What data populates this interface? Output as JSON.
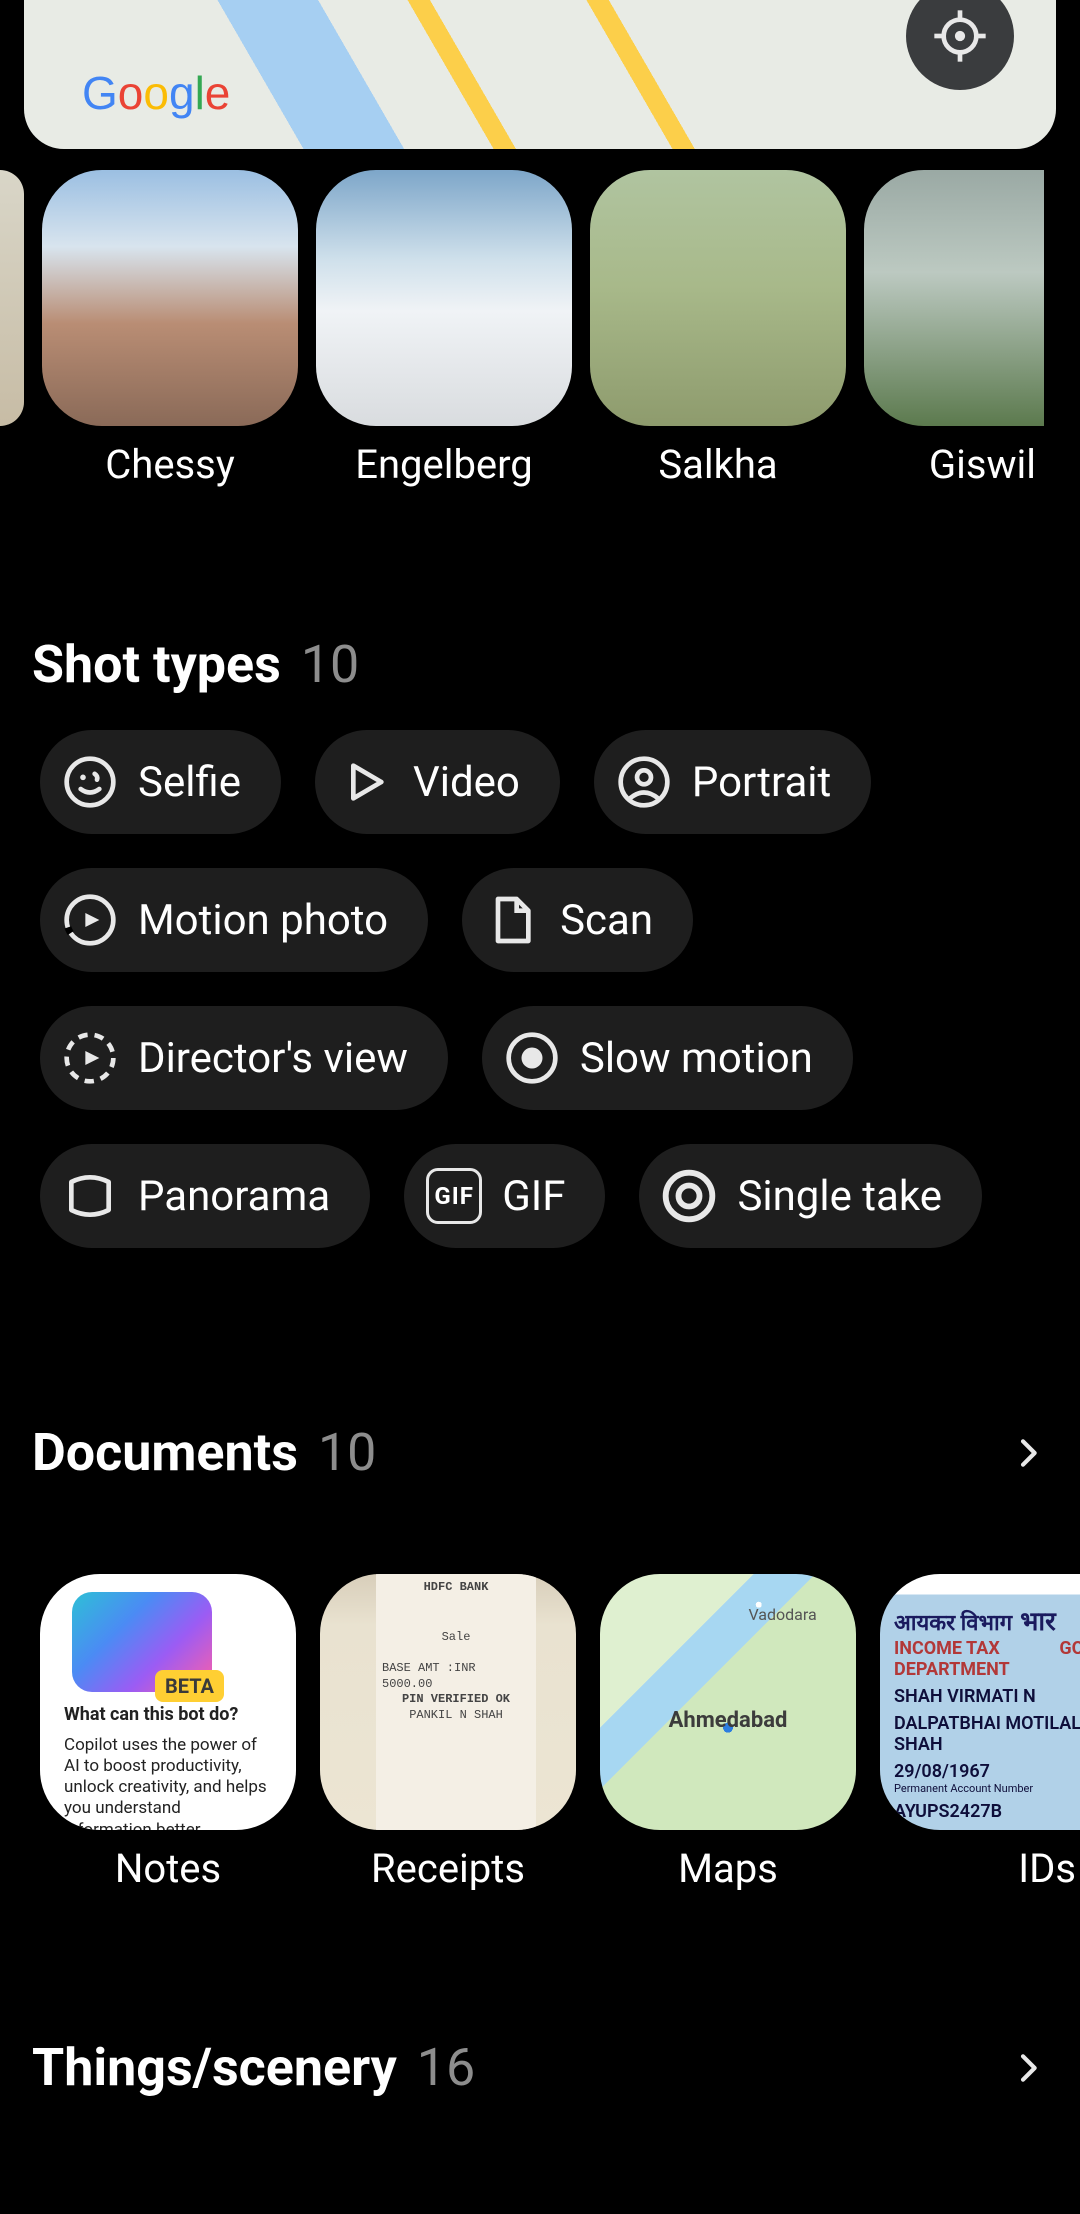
{
  "map": {
    "logo_text_google": "Google"
  },
  "places": [
    {
      "label": "Chessy"
    },
    {
      "label": "Engelberg"
    },
    {
      "label": "Salkha"
    },
    {
      "label": "Giswil"
    }
  ],
  "sections": {
    "shot_types": {
      "title": "Shot types",
      "count": "10"
    },
    "documents": {
      "title": "Documents",
      "count": "10"
    },
    "things": {
      "title": "Things/scenery",
      "count": "16"
    }
  },
  "shot_types": [
    {
      "label": "Selfie"
    },
    {
      "label": "Video"
    },
    {
      "label": "Portrait"
    },
    {
      "label": "Motion photo"
    },
    {
      "label": "Scan"
    },
    {
      "label": "Director's view"
    },
    {
      "label": "Slow motion"
    },
    {
      "label": "Panorama"
    },
    {
      "label": "GIF"
    },
    {
      "label": "Single take"
    }
  ],
  "documents": [
    {
      "label": "Notes"
    },
    {
      "label": "Receipts"
    },
    {
      "label": "Maps"
    },
    {
      "label": "IDs"
    }
  ],
  "doc_thumbs": {
    "notes_heading": "What can this bot do?",
    "notes_body": "Copilot uses the power of AI to boost productivity, unlock creativity, and helps you understand information better.",
    "receipt_bank": "HDFC BANK",
    "receipt_l1": "Sale",
    "receipt_l2": "BASE AMT  :INR   5000.00",
    "receipt_l3": "PIN VERIFIED OK",
    "receipt_l4": "PANKIL N SHAH",
    "maps_city1": "Vadodara",
    "maps_city2": "Ahmedabad",
    "id_hindi": "आयकर विभाग",
    "id_eng1": "INCOME TAX DEPARTMENT",
    "id_gov": "GO",
    "id_name1": "SHAH VIRMATI N",
    "id_name2": "DALPATBHAI MOTILAL SHAH",
    "id_dob": "29/08/1967",
    "id_pan": "AYUPS2427B"
  }
}
